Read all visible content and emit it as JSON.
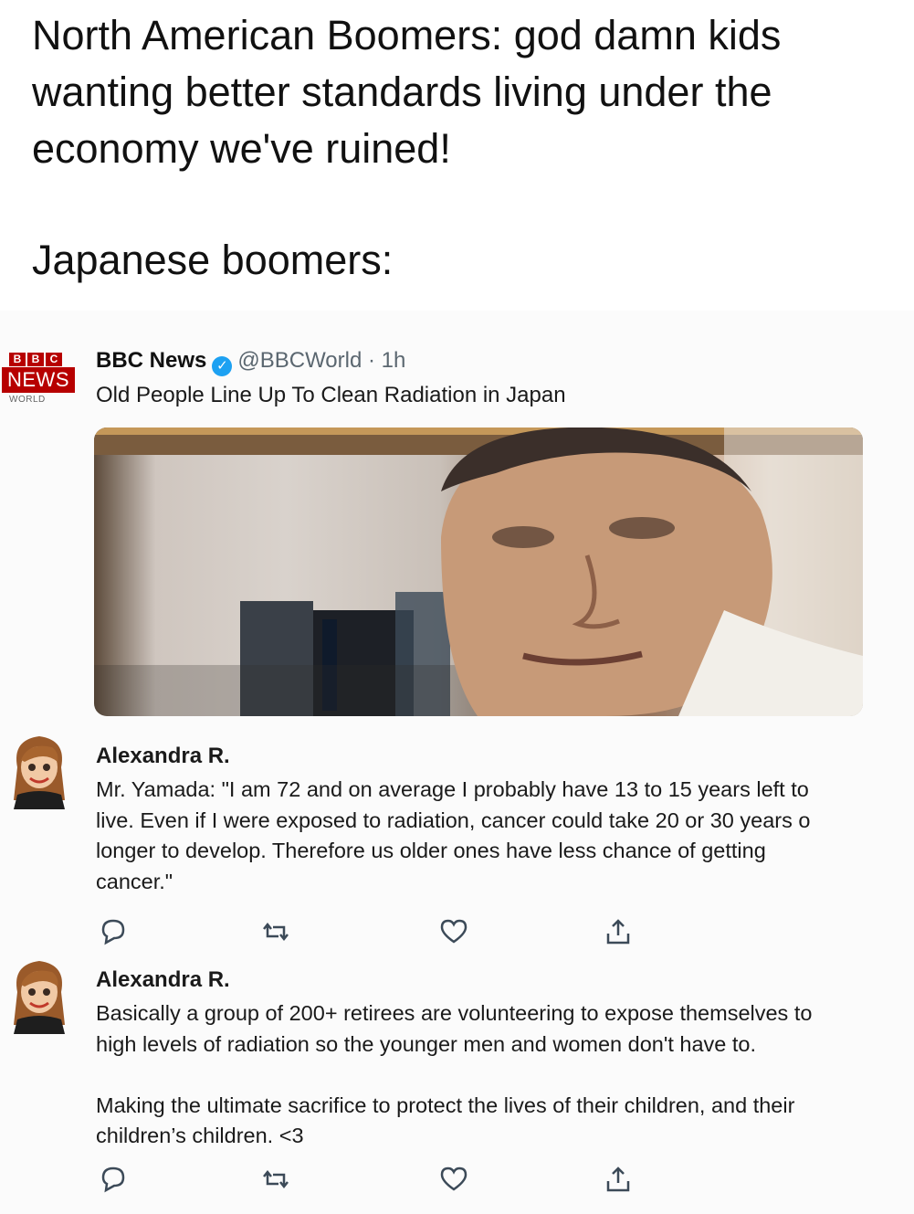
{
  "caption": {
    "line_1": "North American Boomers: god damn kids",
    "line_2": "wanting better standards living under the",
    "line_3": "economy we've ruined!",
    "line_4": "Japanese boomers:"
  },
  "tweet": {
    "avatar": {
      "blocks": [
        "B",
        "B",
        "C"
      ],
      "news": "NEWS",
      "world": "WORLD",
      "brand_color": "#b70000"
    },
    "name": "BBC News",
    "verified_icon": "verified-badge-icon",
    "handle": "@BBCWorld",
    "separator": "·",
    "time": "1h",
    "text": "Old People Line Up To Clean Radiation in Japan",
    "image": "photo of elderly Japanese man"
  },
  "comments": [
    {
      "name": "Alexandra R.",
      "lines": [
        "Mr. Yamada: \"I am 72 and on average I probably have 13 to 15 years left to",
        "live. Even if I were exposed to radiation, cancer could take 20 or 30 years o",
        "longer to develop. Therefore us older ones have less chance of getting",
        "cancer.\""
      ],
      "actions": [
        "reply-icon",
        "retweet-icon",
        "like-icon",
        "share-icon"
      ]
    },
    {
      "name": "Alexandra R.",
      "lines": [
        "Basically a group of 200+ retirees are volunteering to expose themselves to",
        "high levels of radiation so the younger men and women don't have to.",
        "",
        "Making the ultimate sacrifice to protect the lives of their children, and their",
        "children’s children. <3"
      ],
      "actions": [
        "reply-icon",
        "retweet-icon",
        "like-icon",
        "share-icon"
      ]
    }
  ]
}
